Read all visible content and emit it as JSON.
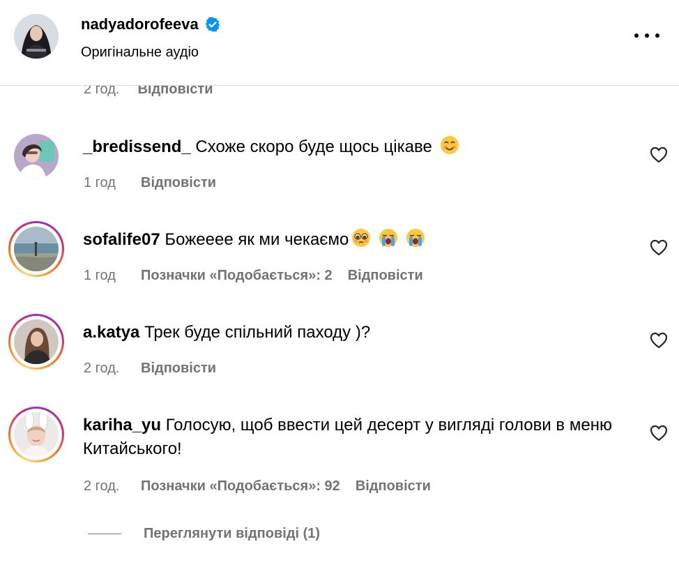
{
  "header": {
    "username": "nadyadorofeeva",
    "subtitle": "Оригінальне аудіо",
    "verified_icon": "verified-badge-icon",
    "more_icon": "more-horizontal-icon"
  },
  "previous_comment_meta": {
    "time": "2 год.",
    "reply": "Відповісти"
  },
  "comments": [
    {
      "username": "_bredissend_",
      "text": "Схоже скоро буде щось цікаве",
      "emoji": [
        "smiling-face-icon"
      ],
      "time": "1 год",
      "likes": "",
      "reply": "Відповісти",
      "story_ring": false
    },
    {
      "username": "sofalife07",
      "text": "Божееее як ми чекаємо",
      "emoji": [
        "pleading-face-icon",
        "crying-face-icon",
        "crying-face-icon"
      ],
      "time": "1 год",
      "likes": "Позначки «Подобається»: 2",
      "reply": "Відповісти",
      "story_ring": true
    },
    {
      "username": "a.katya",
      "text": "Трек буде спільний паходу )?",
      "emoji": [],
      "time": "2 год.",
      "likes": "",
      "reply": "Відповісти",
      "story_ring": true
    },
    {
      "username": "kariha_yu",
      "text": "Голосую, щоб ввести цей десерт у вигляді голови в меню Китайського!",
      "emoji": [],
      "time": "2 год.",
      "likes": "Позначки «Подобається»: 92",
      "reply": "Відповісти",
      "story_ring": true
    }
  ],
  "view_replies": "Переглянути відповіді (1)",
  "colors": {
    "secondary_text": "#737373",
    "verified_blue": "#0095f6",
    "divider": "#dbdbdb"
  }
}
